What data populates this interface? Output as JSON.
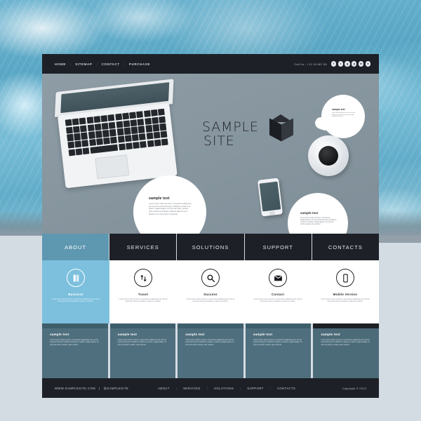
{
  "topbar": {
    "nav": [
      {
        "label": "HOME"
      },
      {
        "label": "SITEMAP"
      },
      {
        "label": "CONTACT"
      },
      {
        "label": "PURCHASE"
      }
    ],
    "separator": "|",
    "call_us": "Call Us : +12 34 567 89",
    "socials": [
      {
        "name": "facebook-icon",
        "glyph": "f"
      },
      {
        "name": "twitter-icon",
        "glyph": "t"
      },
      {
        "name": "google-plus-icon",
        "glyph": "g"
      },
      {
        "name": "pinterest-icon",
        "glyph": "p"
      },
      {
        "name": "linkedin-icon",
        "glyph": "in"
      },
      {
        "name": "rss-icon",
        "glyph": "●"
      }
    ]
  },
  "hero": {
    "logo_line1": "SAMPLE",
    "logo_line2": "SITE",
    "bubbles": [
      {
        "id": "bubble-main",
        "title": "sample text",
        "text": "Lorem ipsum dolor sit amet, consectetur adipiscing elit, sed do eiusmod tempor incididunt ut labore et dolore magna aliqua. Ut enim ad minim veniam, quis nostrud exercitation ullamco laboris nisi ut aliquip ex ea commodo consequat."
      },
      {
        "id": "bubble-phone",
        "title": "sample text",
        "text": "Lorem ipsum dolor sit amet, consectetur adipiscing elit, sed do eiusmod tempor incididunt ut labore et dolore magna aliqua. Ut enim ad minim veniam quis nostrud."
      },
      {
        "id": "bubble-coffee",
        "title": "sample text",
        "text": "Lorem ipsum dolor sit amet consectetur adipiscing elit sed do eiusmod tempor incididunt ut labore."
      }
    ]
  },
  "mainnav": {
    "tabs": [
      {
        "label": "ABOUT",
        "active": true
      },
      {
        "label": "SERVICES",
        "active": false
      },
      {
        "label": "SOLUTIONS",
        "active": false
      },
      {
        "label": "SUPPORT",
        "active": false
      },
      {
        "label": "CONTACTS",
        "active": false
      }
    ],
    "active_color": "#5e97b0",
    "bar_color": "#1d2026"
  },
  "features": [
    {
      "title": "Business",
      "icon": "book-icon",
      "active": true,
      "text": "Lorem ipsum dolor sit amet, consectetur adipiscing elit, sed do eiusmod tempor incididunt ut labore et dolore."
    },
    {
      "title": "Travel",
      "icon": "transfer-arrows-icon",
      "active": false,
      "text": "Lorem ipsum dolor sit amet, consectetur adipiscing elit, sed do eiusmod tempor incididunt ut labore et dolore."
    },
    {
      "title": "Success",
      "icon": "search-icon",
      "active": false,
      "text": "Lorem ipsum dolor sit amet, consectetur adipiscing elit, sed do eiusmod tempor incididunt ut labore et dolore."
    },
    {
      "title": "Contact",
      "icon": "envelope-icon",
      "active": false,
      "text": "Lorem ipsum dolor sit amet, consectetur adipiscing elit, sed do eiusmod tempor incididunt ut labore et dolore."
    },
    {
      "title": "Mobile Version",
      "icon": "mobile-phone-icon",
      "active": false,
      "text": "Lorem ipsum dolor sit amet, consectetur adipiscing elit, sed do eiusmod tempor incididunt ut labore et dolore."
    }
  ],
  "panels": [
    {
      "title": "sample text",
      "text": "Lorem ipsum dolor sit amet, consectetur adipiscing elit, sed do eiusmod tempor incididunt ut labore et dolore magna aliqua. Ut enim ad minim veniam, quis nostrud.",
      "dark_cap": false
    },
    {
      "title": "sample text",
      "text": "Lorem ipsum dolor sit amet, consectetur adipiscing elit, sed do eiusmod tempor incididunt ut labore et dolore magna aliqua. Ut enim ad minim veniam, quis nostrud.",
      "dark_cap": false
    },
    {
      "title": "sample text",
      "text": "Lorem ipsum dolor sit amet, consectetur adipiscing elit, sed do eiusmod tempor incididunt ut labore et dolore magna aliqua. Ut enim ad minim veniam, quis nostrud.",
      "dark_cap": false
    },
    {
      "title": "sample text",
      "text": "Lorem ipsum dolor sit amet, consectetur adipiscing elit, sed do eiusmod tempor incididunt ut labore et dolore magna aliqua. Ut enim ad minim veniam, quis nostrud.",
      "dark_cap": false
    },
    {
      "title": "sample text",
      "text": "Lorem ipsum dolor sit amet, consectetur adipiscing elit, sed do eiusmod tempor incididunt ut labore et dolore magna aliqua. Ut enim ad minim veniam, quis nostrud.",
      "dark_cap": true
    }
  ],
  "footer": {
    "website": "WWW.SAMPLESITE.COM",
    "divider": "|",
    "handle": "@SAMPLESITE",
    "nav": [
      {
        "label": "ABOUT"
      },
      {
        "label": "SERVICES"
      },
      {
        "label": "SOLUTIONS"
      },
      {
        "label": "SUPPORT"
      },
      {
        "label": "CONTACTS"
      }
    ],
    "copyright": "Copyright © 2013"
  },
  "theme": {
    "background": "#d4dce3",
    "dark": "#1d2026",
    "accent_blue": "#5e97b0",
    "light_blue": "#7cc0dd",
    "slate": "#4f6f7e",
    "hero_bg": "#8897a1"
  }
}
